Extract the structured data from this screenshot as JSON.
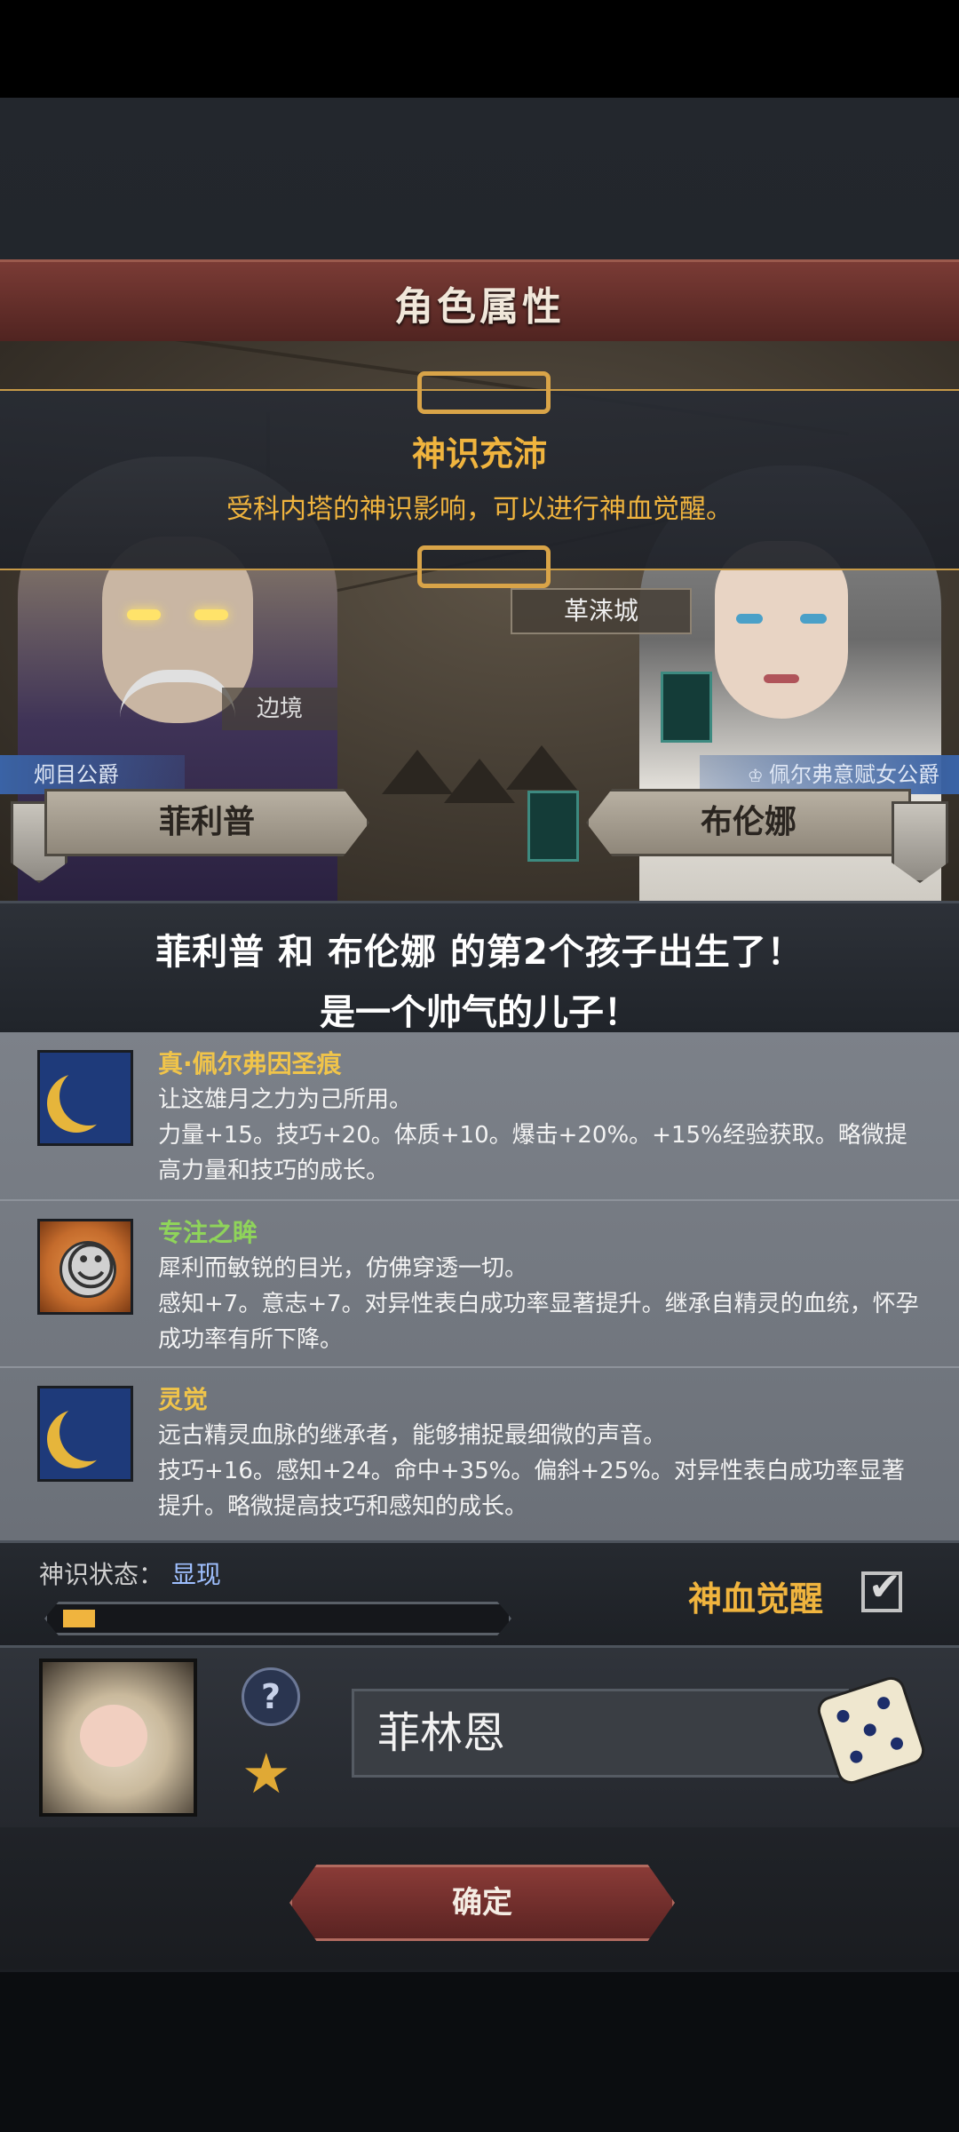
{
  "header": {
    "title": "角色属性"
  },
  "banner": {
    "title": "神识充沛",
    "description": "受科内塔的神识影响，可以进行神血觉醒。"
  },
  "map": {
    "city": "革涞城",
    "region": "边境"
  },
  "parents": {
    "father": {
      "title": "炯目公爵",
      "name": "菲利普"
    },
    "mother": {
      "title": "佩尔弗意赋女公爵",
      "name": "布伦娜"
    }
  },
  "birth": {
    "line1": "菲利普 和 布伦娜 的第2个孩子出生了！",
    "line2": "是一个帅气的儿子！"
  },
  "traits": [
    {
      "name": "真·佩尔弗因圣痕",
      "name_color": "#f0c44a",
      "icon": "crescent-moon-icon",
      "description": "让这雄月之力为己所用。\n力量+15。技巧+20。体质+10。爆击+20%。+15%经验获取。略微提高力量和技巧的成长。"
    },
    {
      "name": "专注之眸",
      "name_color": "#8fd45a",
      "icon": "smiley-face-icon",
      "description": "犀利而敏锐的目光，仿佛穿透一切。\n感知+7。意志+7。对异性表白成功率显著提升。继承自精灵的血统，怀孕成功率有所下降。"
    },
    {
      "name": "灵觉",
      "name_color": "#f0c44a",
      "icon": "crescent-moon-icon",
      "description": "远古精灵血脉的继承者，能够捕捉最细微的声音。\n技巧+16。感知+24。命中+35%。偏斜+25%。对异性表白成功率显著提升。略微提高技巧和感知的成长。"
    }
  ],
  "status": {
    "label": "神识状态：",
    "value": "显现",
    "progress": 0.05
  },
  "awaken": {
    "label": "神血觉醒",
    "checked": true
  },
  "child": {
    "name": "菲林恩"
  },
  "confirm": {
    "label": "确定"
  },
  "colors": {
    "accent": "#f0b43e",
    "title_bar": "#6b302c",
    "status_value": "#9fc0ff"
  }
}
